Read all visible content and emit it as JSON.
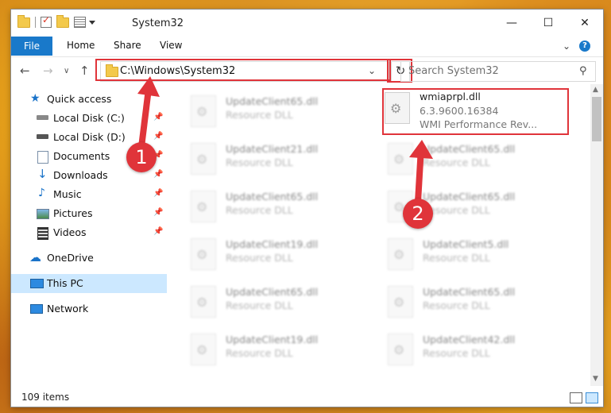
{
  "window": {
    "title": "System32"
  },
  "menu": {
    "file": "File",
    "home": "Home",
    "share": "Share",
    "view": "View"
  },
  "address": {
    "path": "C:\\Windows\\System32"
  },
  "search": {
    "placeholder": "Search System32"
  },
  "sidebar": {
    "items": [
      {
        "label": "Quick access",
        "icon": "star-icon"
      },
      {
        "label": "Local Disk (C:)",
        "icon": "drive-icon",
        "pinned": true
      },
      {
        "label": "Local Disk (D:)",
        "icon": "drive-icon",
        "pinned": true
      },
      {
        "label": "Documents",
        "icon": "documents-icon",
        "pinned": true
      },
      {
        "label": "Downloads",
        "icon": "download-icon",
        "pinned": true
      },
      {
        "label": "Music",
        "icon": "music-icon",
        "pinned": true
      },
      {
        "label": "Pictures",
        "icon": "pictures-icon",
        "pinned": true
      },
      {
        "label": "Videos",
        "icon": "videos-icon",
        "pinned": true
      },
      {
        "label": "OneDrive",
        "icon": "onedrive-icon"
      },
      {
        "label": "This PC",
        "icon": "computer-icon",
        "selected": true
      },
      {
        "label": "Network",
        "icon": "network-icon"
      }
    ]
  },
  "files": {
    "left": [
      {
        "name": "UpdateClient65.dll",
        "type": "Resource DLL"
      },
      {
        "name": "UpdateClient21.dll",
        "type": "Resource DLL"
      },
      {
        "name": "UpdateClient65.dll",
        "type": "Resource DLL"
      },
      {
        "name": "UpdateClient19.dll",
        "type": "Resource DLL"
      },
      {
        "name": "UpdateClient65.dll",
        "type": "Resource DLL"
      },
      {
        "name": "UpdateClient19.dll",
        "type": "Resource DLL"
      }
    ],
    "right": [
      {
        "name": "wmiaprpl.dll",
        "version": "6.3.9600.16384",
        "type": "WMI Performance Rev..."
      },
      {
        "name": "UpdateClient65.dll",
        "type": "Resource DLL"
      },
      {
        "name": "UpdateClient65.dll",
        "type": "Resource DLL"
      },
      {
        "name": "UpdateClient5.dll",
        "type": "Resource DLL"
      },
      {
        "name": "UpdateClient65.dll",
        "type": "Resource DLL"
      },
      {
        "name": "UpdateClient42.dll",
        "type": "Resource DLL"
      }
    ]
  },
  "status": {
    "items_count": "109 items"
  },
  "annotations": {
    "badge1": "1",
    "badge2": "2",
    "color": "#e0343a"
  }
}
